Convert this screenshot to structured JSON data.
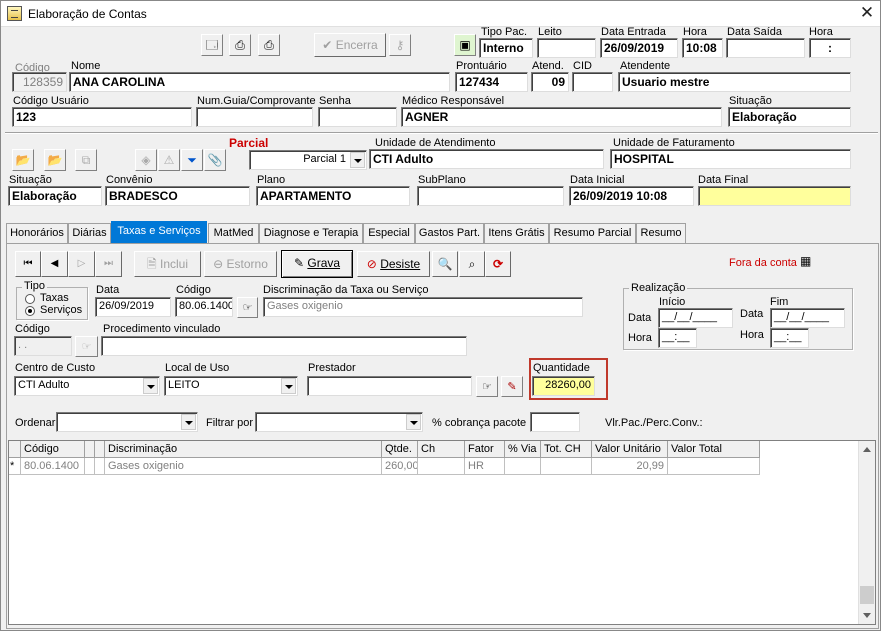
{
  "window": {
    "title": "Elaboração de Contas"
  },
  "toolbar": {
    "encerra_label": "Encerra"
  },
  "header": {
    "tipo_pac_label": "Tipo Pac.",
    "tipo_pac": "Interno",
    "leito_label": "Leito",
    "leito": "",
    "data_entrada_label": "Data Entrada",
    "data_entrada": "26/09/2019",
    "hora_label": "Hora",
    "hora_entrada": "10:08",
    "data_saida_label": "Data Saída",
    "data_saida": "",
    "hora2_label": "Hora",
    "hora_saida": ":",
    "codigo_label": "Código",
    "codigo": "128359",
    "nome_label": "Nome",
    "nome": "ANA  CAROLINA",
    "prontuario_label": "Prontuário",
    "prontuario": "127434",
    "atend_label": "Atend.",
    "atend": "09",
    "cid_label": "CID",
    "cid": "",
    "atendente_label": "Atendente",
    "atendente": "Usuario mestre",
    "codigo_usuario_label": "Código Usuário",
    "codigo_usuario": "123",
    "num_guia_label": "Num.Guia/Comprovante",
    "num_guia": "",
    "senha_label": "Senha",
    "senha": "",
    "medico_label": "Médico Responsável",
    "medico": "AGNER",
    "situacao_label": "Situação",
    "situacao": "Elaboração"
  },
  "parcial": {
    "title": "Parcial",
    "selected": "Parcial 1",
    "unidade_atend_label": "Unidade de Atendimento",
    "unidade_atend": "CTI Adulto",
    "unidade_fat_label": "Unidade de Faturamento",
    "unidade_fat": "HOSPITAL",
    "situacao_label": "Situação",
    "situacao": "Elaboração",
    "convenio_label": "Convênio",
    "convenio": "BRADESCO",
    "plano_label": "Plano",
    "plano": "APARTAMENTO",
    "subplano_label": "SubPlano",
    "subplano": "",
    "data_inicial_label": "Data Inicial",
    "data_inicial": "26/09/2019 10:08",
    "data_final_label": "Data Final",
    "data_final": ""
  },
  "tabs": [
    "Honorários",
    "Diárias",
    "Taxas e Serviços",
    "MatMed",
    "Diagnose e Terapia",
    "Especial",
    "Gastos Part.",
    "Itens Grátis",
    "Resumo Parcial",
    "Resumo"
  ],
  "actions": {
    "inclui": "Inclui",
    "estorno": "Estorno",
    "grava": "Grava",
    "desiste": "Desiste",
    "fora_da_conta": "Fora da conta"
  },
  "form": {
    "tipo_label": "Tipo",
    "taxas_label": "Taxas",
    "servicos_label": "Serviços",
    "data_label": "Data",
    "data": "26/09/2019",
    "codigo_label": "Código",
    "codigo": "80.06.1400",
    "discriminacao_label": "Discriminação da Taxa ou Serviço",
    "discriminacao": "Gases oxigenio",
    "codigo2_label": "Código",
    "codigo2": " .  .",
    "procedimento_label": "Procedimento vinculado",
    "procedimento": "",
    "centro_custo_label": "Centro de Custo",
    "centro_custo": "CTI Adulto",
    "local_uso_label": "Local de Uso",
    "local_uso": "LEITO",
    "prestador_label": "Prestador",
    "prestador": "",
    "quantidade_label": "Quantidade",
    "quantidade": "28260,00",
    "ordenar_label": "Ordenar",
    "filtrar_label": "Filtrar por",
    "cobranca_label": "% cobrança pacote",
    "vlr_pac_label": "Vlr.Pac./Perc.Conv.:"
  },
  "realizacao": {
    "title": "Realização",
    "inicio_label": "Início",
    "fim_label": "Fim",
    "data_label": "Data",
    "hora_label": "Hora",
    "inicio_data": "__/__/____",
    "inicio_hora": "__:__",
    "fim_data": "__/__/____",
    "fim_hora": "__:__"
  },
  "grid": {
    "columns": [
      "Código",
      "",
      "Discriminação",
      "Qtde.",
      "Ch",
      "Fator",
      "% Via",
      "Tot. CH",
      "Valor Unitário",
      "Valor Total"
    ],
    "rows": [
      {
        "marker": "*",
        "codigo": "80.06.1400",
        "flag": "",
        "discriminacao": "Gases oxigenio",
        "qtde": "260,00",
        "ch": "",
        "fator": "HR",
        "via": "",
        "tot_ch": "",
        "valor_unitario": "20,99",
        "valor_total": ""
      }
    ]
  }
}
